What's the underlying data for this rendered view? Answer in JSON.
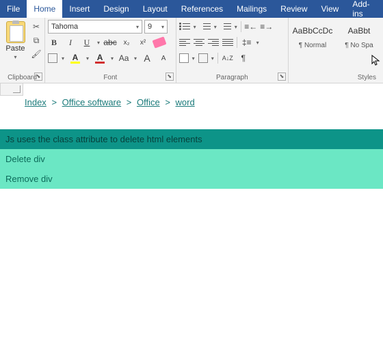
{
  "tabs": [
    "File",
    "Home",
    "Insert",
    "Design",
    "Layout",
    "References",
    "Mailings",
    "Review",
    "View",
    "Add-ins"
  ],
  "active_tab": "Home",
  "clipboard": {
    "paste": "Paste",
    "label": "Clipboard"
  },
  "font": {
    "family": "Tahoma",
    "size": "9",
    "bold": "B",
    "italic": "I",
    "underline": "U",
    "strike": "abc",
    "sub": "x₂",
    "sup": "x²",
    "grow": "A",
    "shrink": "A",
    "case": "Aa",
    "highlight_letter": "A",
    "highlight_color": "#ffff00",
    "font_color_letter": "A",
    "font_color": "#d12f2f",
    "label": "Font"
  },
  "paragraph": {
    "sort": "A↓Z",
    "pilcrow": "¶",
    "label": "Paragraph"
  },
  "styles": {
    "items": [
      {
        "preview": "AaBbCcDc",
        "name": "¶ Normal"
      },
      {
        "preview": "AaBbt",
        "name": "¶ No Spa"
      }
    ],
    "label": "Styles"
  },
  "breadcrumb": [
    "Index",
    "Office software",
    "Office",
    "word"
  ],
  "content": {
    "title": "Js uses the class attribute to delete html elements",
    "row1": "Delete div",
    "row2": "Remove div"
  }
}
